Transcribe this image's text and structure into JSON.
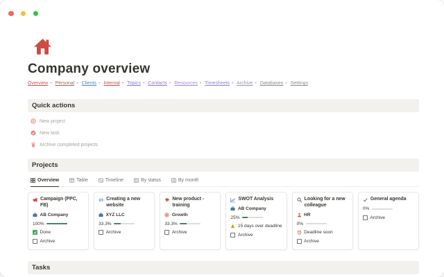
{
  "window": {
    "controls": [
      {
        "name": "close",
        "color": "#ff5f57"
      },
      {
        "name": "minimize",
        "color": "#febc2e"
      },
      {
        "name": "zoom",
        "color": "#28c840"
      }
    ]
  },
  "header": {
    "title": "Company overview",
    "nav_separator": "•",
    "nav": [
      {
        "label": "Overview",
        "color": "#d5544d"
      },
      {
        "label": "Personal",
        "color": "#9a6a5f"
      },
      {
        "label": "Clients",
        "color": "#5089c4"
      },
      {
        "label": "Internal",
        "color": "#c4554d"
      },
      {
        "label": "Topics",
        "color": "#8a7cc9"
      },
      {
        "label": "Contacts",
        "color": "#9479c7"
      },
      {
        "label": "Resources",
        "color": "#a48bd1"
      },
      {
        "label": "Timesheets",
        "color": "#8f86cf"
      },
      {
        "label": "Archive",
        "color": "#9b97a8"
      },
      {
        "label": "Databases",
        "color": "#8f8d8a"
      },
      {
        "label": "Settings",
        "color": "#8f8d8a"
      }
    ]
  },
  "quick_actions": {
    "heading": "Quick actions",
    "items": [
      {
        "icon": "plus-circle-icon",
        "label": "New project"
      },
      {
        "icon": "check-circle-icon",
        "label": "New task"
      },
      {
        "icon": "trash-icon",
        "label": "Archive completed projects"
      }
    ]
  },
  "projects": {
    "heading": "Projects",
    "tabs": [
      {
        "icon": "grid-icon",
        "label": "Overview",
        "active": true
      },
      {
        "icon": "table-icon",
        "label": "Table"
      },
      {
        "icon": "timeline-icon",
        "label": "Timeline"
      },
      {
        "icon": "board-icon",
        "label": "By status"
      },
      {
        "icon": "board-icon",
        "label": "By month"
      }
    ],
    "cards": [
      {
        "icon": "megaphone-icon",
        "title": "Campaign (PPC, FB)",
        "client": "AB Company",
        "progress_label": "100%",
        "progress_pct": 100,
        "status_label": "Done",
        "status_checked": true,
        "archive_label": "Archive"
      },
      {
        "icon": "code-icon",
        "title": "Creating a new website",
        "client": "XYZ LLC",
        "progress_label": "33.3%",
        "progress_pct": 33,
        "archive_label": "Archive"
      },
      {
        "icon": "graduation-cap-icon",
        "title": "New product - training",
        "tag_icon": "target-icon",
        "tag_label": "Growth",
        "progress_label": "33.3%",
        "progress_pct": 33,
        "archive_label": "Archive"
      },
      {
        "icon": "line-chart-icon",
        "title": "SWOT Analysis",
        "client": "AB Company",
        "progress_label": "25%",
        "progress_pct": 25,
        "warning_icon": "warning-icon",
        "warning_label": "15 days over deadline",
        "archive_label": "Archive"
      },
      {
        "icon": "magnifier-icon",
        "title": "Looking for a new colleague",
        "tag_icon": "person-icon",
        "tag_label": "HR",
        "progress_label": "0%",
        "progress_pct": 0,
        "alert_icon": "alarm-clock-icon",
        "alert_label": "Deadline soon",
        "archive_label": "Archive"
      },
      {
        "icon": "check-icon",
        "title": "General agenda",
        "progress_label": "0%",
        "progress_pct": 0,
        "archive_label": "Archive"
      }
    ]
  },
  "tasks": {
    "heading": "Tasks"
  },
  "colors": {
    "accent_red": "#cf4a42",
    "progress_green": "#448361",
    "checkbox_green": "#47ab4e",
    "warning_yellow": "#f3b33d",
    "link_blue": "#4878a8",
    "muted_text": "#a6a39e",
    "heading_bg": "#f2f1ee"
  }
}
